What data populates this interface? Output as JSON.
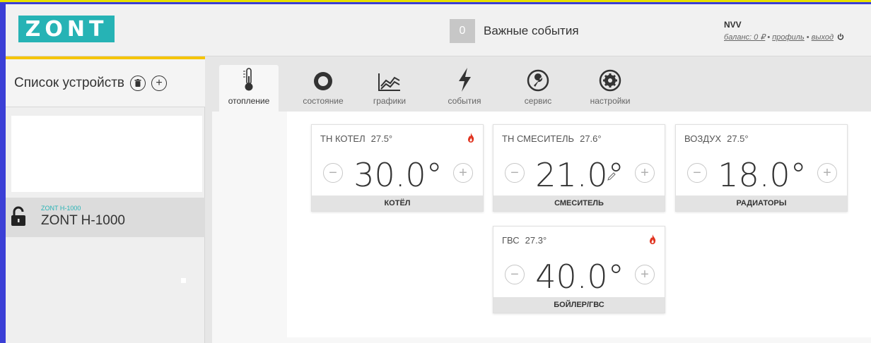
{
  "header": {
    "logo": "ZONT",
    "events_count": "0",
    "events_label": "Важные события",
    "user": "NVV",
    "links": {
      "balance": "баланс: 0 ₽",
      "profile": "профиль",
      "logout": "выход"
    },
    "link_sep": "•"
  },
  "sidebar": {
    "title": "Список устройств",
    "delete_glyph": "⊝",
    "add_glyph": "+",
    "device": {
      "model": "ZONT H-1000",
      "name": "ZONT H-1000"
    }
  },
  "tabs": [
    {
      "label": "отопление",
      "icon": "thermometer-icon"
    },
    {
      "label": "состояние",
      "icon": "circle-icon"
    },
    {
      "label": "графики",
      "icon": "chart-icon"
    },
    {
      "label": "события",
      "icon": "lightning-icon"
    },
    {
      "label": "сервис",
      "icon": "wrench-icon"
    },
    {
      "label": "настройки",
      "icon": "gear-icon"
    }
  ],
  "circuits": [
    {
      "sensor": "ТН КОТЕЛ",
      "temp": "27.5°",
      "setpoint": "30.0°",
      "name": "КОТЁЛ",
      "flame": true
    },
    {
      "sensor": "ТН СМЕСИТЕЛЬ",
      "temp": "27.6°",
      "setpoint": "21.0°",
      "name": "СМЕСИТЕЛЬ",
      "flame": false
    },
    {
      "sensor": "ВОЗДУХ",
      "temp": "27.5°",
      "setpoint": "18.0°",
      "name": "РАДИАТОРЫ",
      "flame": false
    },
    {
      "sensor": "ГВС",
      "temp": "27.3°",
      "setpoint": "40.0°",
      "name": "БОЙЛЕР/ГВС",
      "flame": true
    }
  ],
  "stepper": {
    "minus": "−",
    "plus": "+"
  },
  "colors": {
    "accent": "#26b3b5",
    "frame": "#3b3fd6",
    "flame": "#e0331f"
  }
}
